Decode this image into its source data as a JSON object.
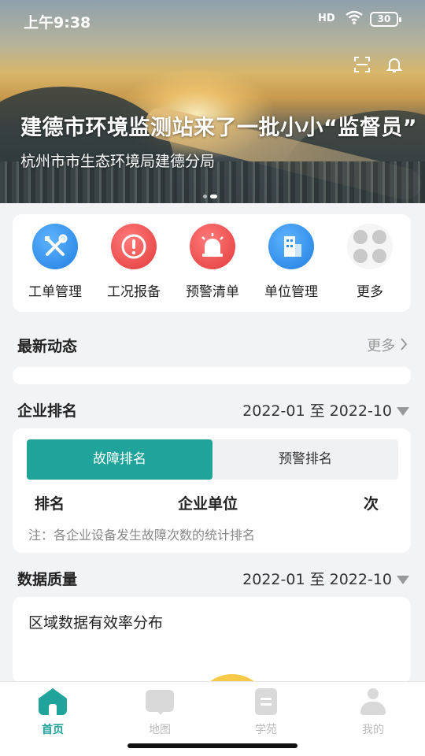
{
  "status_bar": {
    "time": "上午9:38",
    "signal": "HD",
    "battery": "30"
  },
  "banner": {
    "headline": "建德市环境监测站来了一批小小“监督员”",
    "subline": "杭州市市生态环境局建德分局",
    "scan_icon": "scan-icon",
    "bell_icon": "bell-icon"
  },
  "quick_actions": [
    {
      "label": "工单管理",
      "icon": "tools-icon",
      "color": "#2b8ff0"
    },
    {
      "label": "工况报备",
      "icon": "alert-icon",
      "color": "#e84646"
    },
    {
      "label": "预警清单",
      "icon": "siren-icon",
      "color": "#e84646"
    },
    {
      "label": "单位管理",
      "icon": "building-icon",
      "color": "#2b8ff0"
    },
    {
      "label": "更多",
      "icon": "more-icon",
      "color": "#c9c9c9"
    }
  ],
  "news": {
    "title": "最新动态",
    "more": "更多"
  },
  "ranking": {
    "title": "企业排名",
    "date_range": "2022-01 至 2022-10",
    "tabs": [
      "故障排名",
      "预警排名"
    ],
    "columns": [
      "排名",
      "企业单位",
      "次"
    ],
    "note": "注：各企业设备发生故障次数的统计排名"
  },
  "quality": {
    "title": "数据质量",
    "date_range": "2022-01 至 2022-10",
    "card_title": "区域数据有效率分布"
  },
  "tabbar": {
    "items": [
      "首页",
      "地图",
      "学苑",
      "我的"
    ],
    "active_color": "#1fa39a"
  }
}
